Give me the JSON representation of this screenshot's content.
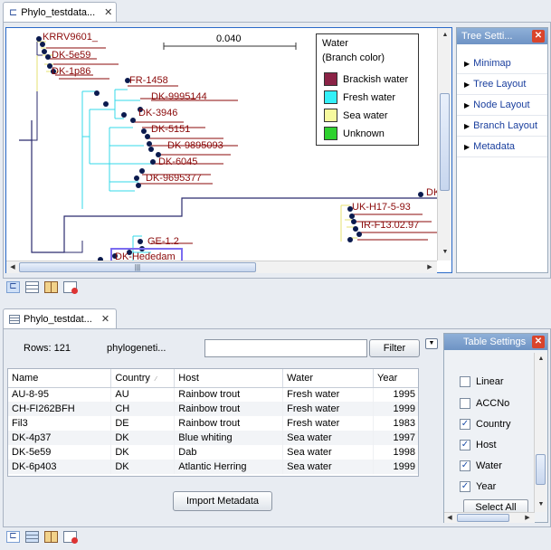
{
  "tree_tab": {
    "title": "Phylo_testdata...",
    "close": "✕"
  },
  "tree_view": {
    "scale_label": "0.040",
    "legend": {
      "title": "Water",
      "subtitle": "(Branch color)",
      "items": [
        {
          "label": "Brackish water",
          "color": "#8b2346"
        },
        {
          "label": "Fresh water",
          "color": "#33e8f5"
        },
        {
          "label": "Sea water",
          "color": "#f4f79a"
        },
        {
          "label": "Unknown",
          "color": "#2fd12f"
        }
      ]
    },
    "leaves": [
      "KRRV9601_",
      "DK-5e59",
      "DK-1p86",
      "FR-1458",
      "DK-9995144",
      "DK-3946",
      "DK-5151",
      "DK-9895093",
      "DK-6045",
      "DK-9695377",
      "GE-1.2",
      "DK-Hededam",
      "UK-H17-5-93",
      "IR-F13.02.97",
      "DK"
    ],
    "scroll_grip": "|||"
  },
  "tree_settings": {
    "title": "Tree Setti...",
    "close": "✕",
    "items": [
      "Minimap",
      "Tree Layout",
      "Node Layout",
      "Branch Layout",
      "Metadata"
    ]
  },
  "table_tab": {
    "title": "Phylo_testdat...",
    "close": "✕"
  },
  "table_view": {
    "rows_label": "Rows: 121",
    "filter_column": "phylogeneti...",
    "filter_value": "",
    "filter_button": "Filter",
    "columns": [
      "Name",
      "Country",
      "Host",
      "Water",
      "Year"
    ],
    "rows": [
      [
        "AU-8-95",
        "AU",
        "Rainbow trout",
        "Fresh water",
        "1995"
      ],
      [
        "CH-FI262BFH",
        "CH",
        "Rainbow trout",
        "Fresh water",
        "1999"
      ],
      [
        "Fil3",
        "DE",
        "Rainbow trout",
        "Fresh water",
        "1983"
      ],
      [
        "DK-4p37",
        "DK",
        "Blue whiting",
        "Sea water",
        "1997"
      ],
      [
        "DK-5e59",
        "DK",
        "Dab",
        "Sea water",
        "1998"
      ],
      [
        "DK-6p403",
        "DK",
        "Atlantic Herring",
        "Sea water",
        "1999"
      ]
    ],
    "import_button": "Import Metadata"
  },
  "table_settings": {
    "title": "Table Settings",
    "close": "✕",
    "options": [
      {
        "label": "Linear",
        "checked": false
      },
      {
        "label": "ACCNo",
        "checked": false
      },
      {
        "label": "Country",
        "checked": true
      },
      {
        "label": "Host",
        "checked": true
      },
      {
        "label": "Water",
        "checked": true
      },
      {
        "label": "Year",
        "checked": true
      }
    ],
    "select_all": "Select All"
  }
}
